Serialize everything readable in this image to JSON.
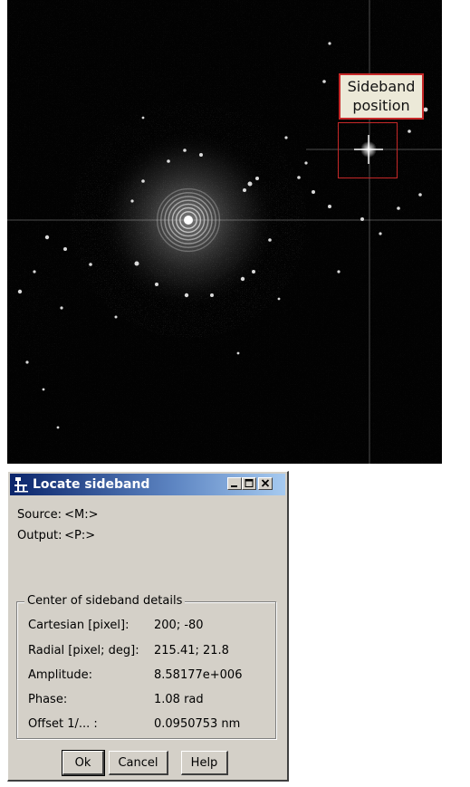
{
  "image": {
    "annotation": {
      "label_line1": "Sideband",
      "label_line2": "position"
    },
    "colors": {
      "background": "#020202",
      "annotation_border": "#c62828"
    }
  },
  "dialog": {
    "title": "Locate sideband",
    "title_icon": "tool-icon",
    "window_buttons": [
      "minimize-icon",
      "maximize-icon",
      "close-icon"
    ],
    "source_label": "Source:",
    "source_value": "<M:>",
    "output_label": "Output:",
    "output_value": "<P:>",
    "group_title": "Center of sideband details",
    "rows": [
      {
        "label": "Cartesian [pixel]:",
        "value": "200;  -80"
      },
      {
        "label": "Radial [pixel; deg]:",
        "value": "215.41;  21.8"
      },
      {
        "label": "Amplitude:",
        "value": "8.58177e+006"
      },
      {
        "label": "Phase:",
        "value": "1.08 rad"
      },
      {
        "label": "Offset 1/... :",
        "value": "0.0950753 nm"
      }
    ],
    "buttons": {
      "ok": "Ok",
      "cancel": "Cancel",
      "help": "Help"
    },
    "colors": {
      "title_start": "#0a246a",
      "title_end": "#a6caf0",
      "face": "#d4d0c8"
    }
  }
}
